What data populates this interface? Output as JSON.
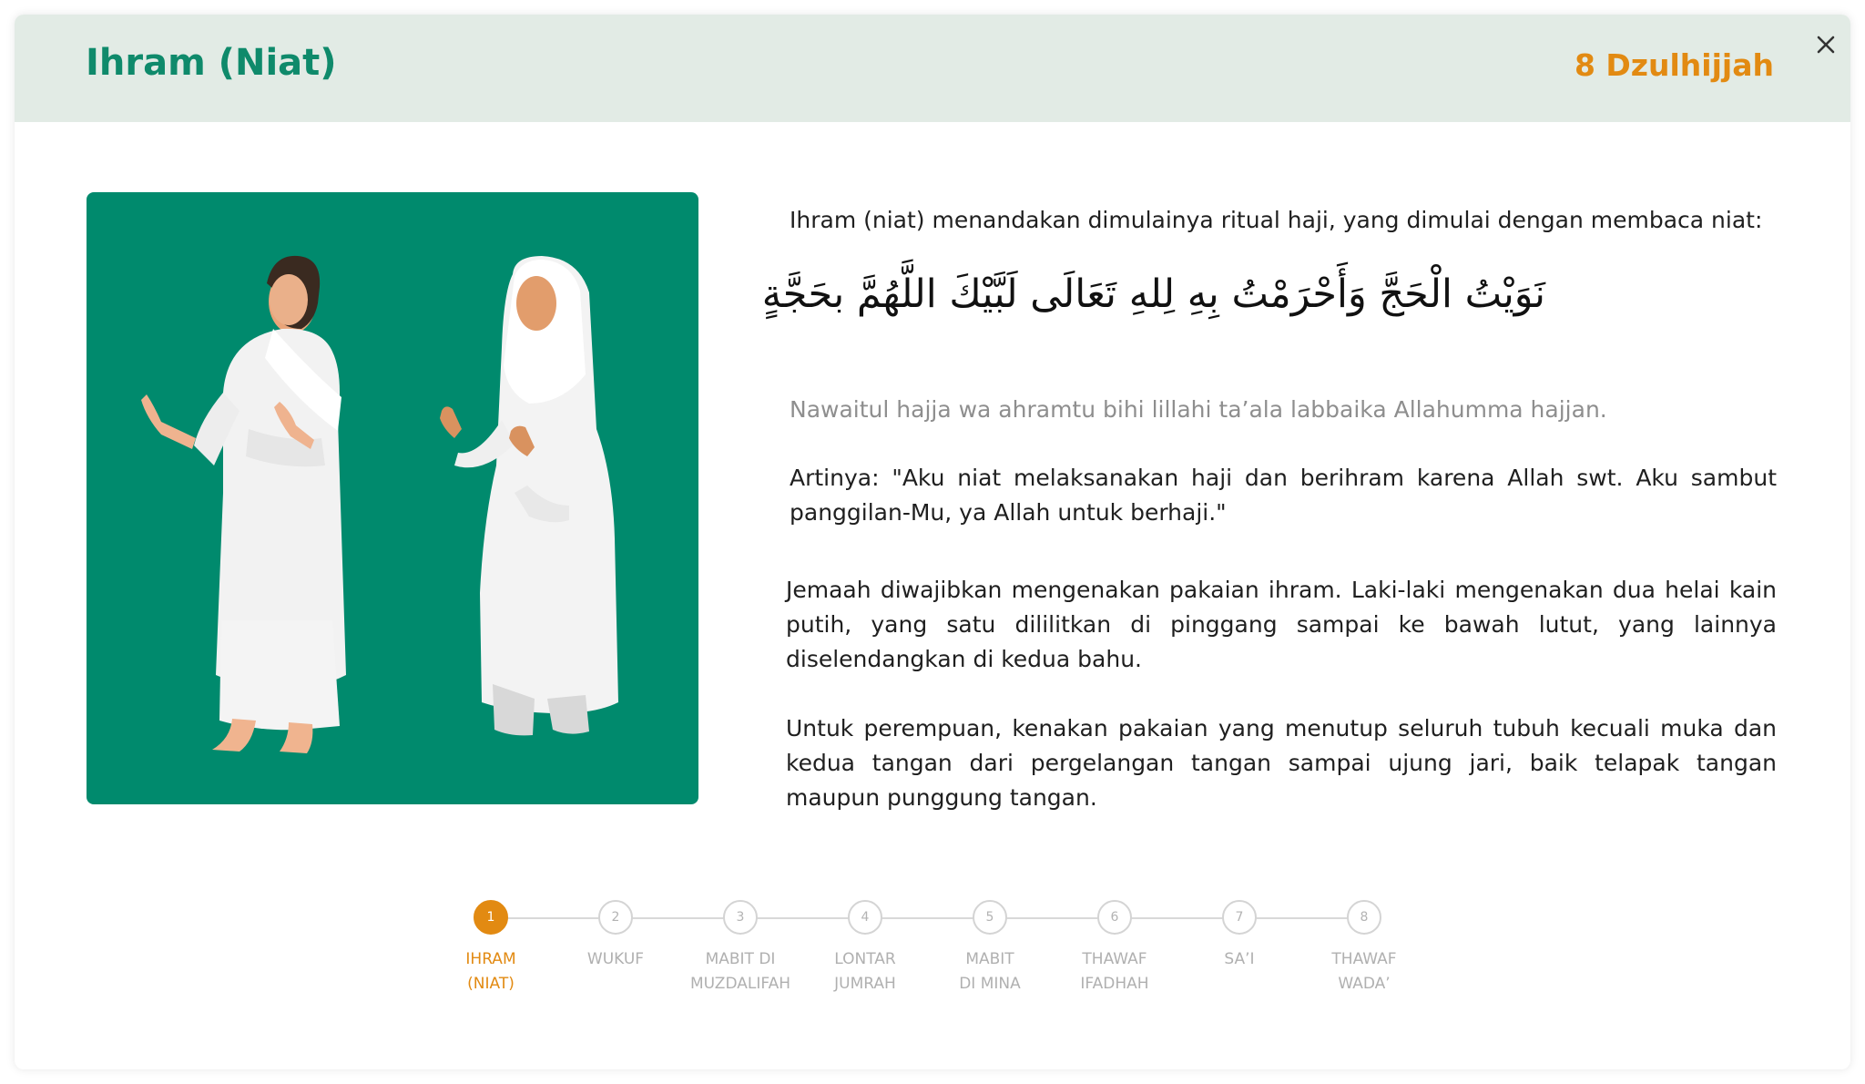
{
  "header": {
    "title": "Ihram (Niat)",
    "date": "8 Dzulhijjah",
    "close_icon": "close-icon"
  },
  "colors": {
    "header_bg": "#e2ebe5",
    "title": "#0f8a6b",
    "accent": "#e28a12",
    "illustration_bg": "#008a6d"
  },
  "illustration": {
    "icon": "pilgrims-in-ihram-illustration"
  },
  "content": {
    "intro": "Ihram (niat) menandakan dimulainya ritual haji, yang dimulai dengan membaca niat:",
    "arabic": "نَوَيْتُ الْحَجَّ وَأَحْرَمْتُ بِهِ لِلهِ تَعَالَى لَبَّيْكَ اللَّهُمَّ بحَجَّةٍ",
    "transliteration": "Nawaitul hajja wa ahramtu bihi lillahi ta’ala labbaika Allahumma hajjan.",
    "meaning": "Artinya: \"Aku niat melaksanakan haji dan berihram karena Allah swt. Aku sambut panggilan-Mu, ya Allah untuk berhaji.\"",
    "paragraph1": "Jemaah diwajibkan mengenakan pakaian ihram. Laki-laki mengenakan dua helai kain putih, yang satu dililitkan di pinggang sampai ke bawah lutut, yang lainnya diselendangkan di kedua bahu.",
    "paragraph2": "Untuk perempuan, kenakan pakaian yang menutup seluruh tubuh kecuali muka dan kedua tangan dari pergelangan tangan sampai ujung jari, baik telapak tangan maupun punggung tangan."
  },
  "steps": [
    {
      "num": "1",
      "line1": "IHRAM",
      "line2": "(NIAT)",
      "active": true
    },
    {
      "num": "2",
      "line1": "WUKUF",
      "line2": "",
      "active": false
    },
    {
      "num": "3",
      "line1": "MABIT DI",
      "line2": "MUZDALIFAH",
      "active": false
    },
    {
      "num": "4",
      "line1": "LONTAR",
      "line2": "JUMRAH",
      "active": false
    },
    {
      "num": "5",
      "line1": "MABIT",
      "line2": "DI MINA",
      "active": false
    },
    {
      "num": "6",
      "line1": "THAWAF",
      "line2": "IFADHAH",
      "active": false
    },
    {
      "num": "7",
      "line1": "SA’I",
      "line2": "",
      "active": false
    },
    {
      "num": "8",
      "line1": "THAWAF",
      "line2": "WADA’",
      "active": false
    }
  ]
}
